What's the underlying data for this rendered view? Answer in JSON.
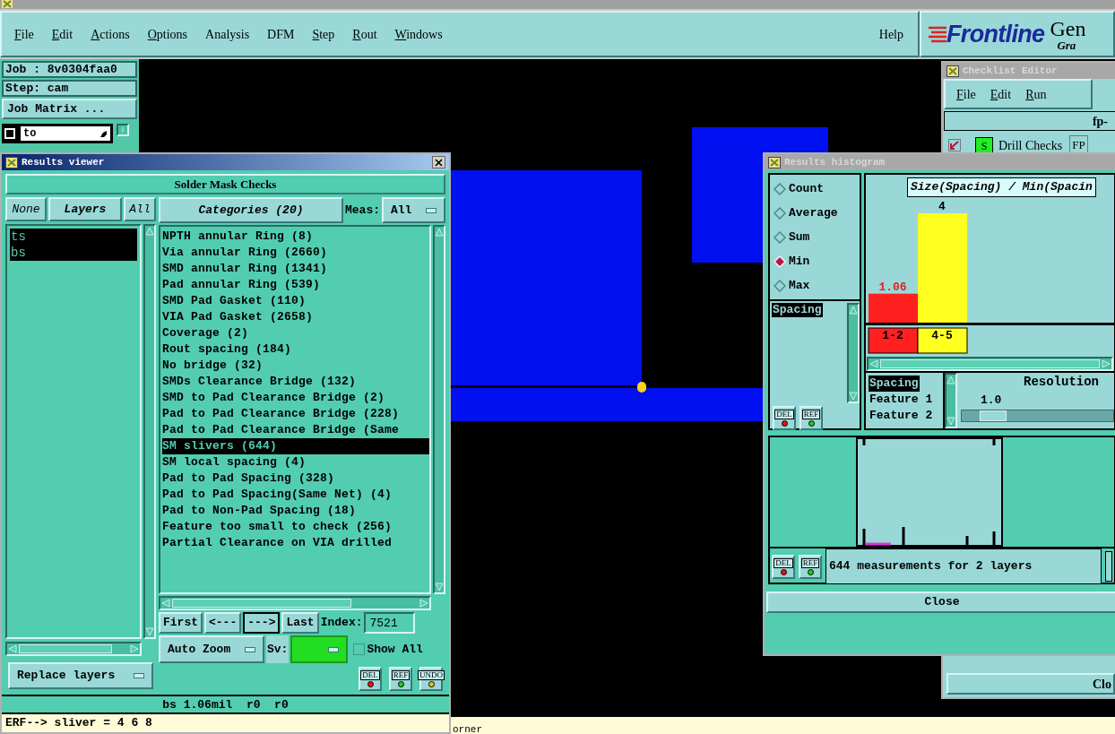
{
  "menu_bar": {
    "items": [
      {
        "label": "File",
        "mnemonic": true
      },
      {
        "label": "Edit",
        "mnemonic": true
      },
      {
        "label": "Actions",
        "mnemonic": true
      },
      {
        "label": "Options",
        "mnemonic": true
      },
      {
        "label": "Analysis",
        "mnemonic": false
      },
      {
        "label": "DFM",
        "mnemonic": false
      },
      {
        "label": "Step",
        "mnemonic": true
      },
      {
        "label": "Rout",
        "mnemonic": true
      },
      {
        "label": "Windows",
        "mnemonic": true
      }
    ],
    "help": "Help",
    "logo": "Frontline",
    "product": "Gen",
    "product_sub": "Gra"
  },
  "side_panel": {
    "job": "Job : 8v0304faa0",
    "step": "Step: cam",
    "job_matrix": "Job Matrix ...",
    "layer_row": {
      "checked": false,
      "value": "to"
    }
  },
  "status_line": "orner",
  "checklist_editor": {
    "title": "Checklist Editor",
    "menu": [
      "File",
      "Edit",
      "Run"
    ],
    "checklist_name": "fp-",
    "rows": [
      {
        "checked": true,
        "status": "S",
        "name": "Drill Checks",
        "column_3": "FP"
      }
    ],
    "close": "Clo"
  },
  "results_viewer": {
    "title": "Results viewer",
    "heading": "Solder Mask Checks",
    "layer_buttons": {
      "none": "None",
      "layers": "Layers",
      "all": "All"
    },
    "layers": [
      {
        "name": "ts",
        "selected": true
      },
      {
        "name": "bs",
        "selected": true
      }
    ],
    "categories_button": "Categories (20)",
    "meas_label": "Meas:",
    "meas_value": "All",
    "categories": [
      {
        "label": "NPTH annular Ring (8)",
        "selected": false
      },
      {
        "label": "Via annular Ring (2660)",
        "selected": false
      },
      {
        "label": "SMD annular Ring (1341)",
        "selected": false
      },
      {
        "label": "Pad annular Ring (539)",
        "selected": false
      },
      {
        "label": "SMD Pad Gasket (110)",
        "selected": false
      },
      {
        "label": "VIA Pad Gasket (2658)",
        "selected": false
      },
      {
        "label": "Coverage (2)",
        "selected": false
      },
      {
        "label": "Rout spacing (184)",
        "selected": false
      },
      {
        "label": "No bridge (32)",
        "selected": false
      },
      {
        "label": "SMDs Clearance Bridge (132)",
        "selected": false
      },
      {
        "label": "SMD to Pad Clearance Bridge (2)",
        "selected": false
      },
      {
        "label": "Pad to Pad Clearance Bridge (228)",
        "selected": false
      },
      {
        "label": "Pad to Pad Clearance Bridge (Same",
        "selected": false
      },
      {
        "label": "SM slivers (644)",
        "selected": true
      },
      {
        "label": "SM local spacing (4)",
        "selected": false
      },
      {
        "label": "Pad to Pad Spacing (328)",
        "selected": false
      },
      {
        "label": "Pad to Pad Spacing(Same Net) (4)",
        "selected": false
      },
      {
        "label": "Pad to Non-Pad Spacing (18)",
        "selected": false
      },
      {
        "label": "Feature too small to check (256)",
        "selected": false
      },
      {
        "label": "Partial Clearance on VIA drilled",
        "selected": false
      }
    ],
    "nav": [
      {
        "label": "First",
        "selected": false
      },
      {
        "label": "<---",
        "selected": false
      },
      {
        "label": "--->",
        "selected": true
      },
      {
        "label": "Last",
        "selected": false
      }
    ],
    "index_label": "Index:",
    "index_value": "7521",
    "replace_layers": "Replace layers",
    "zoom": "Auto Zoom",
    "sv_label": "Sv:",
    "show_all": {
      "label": "Show All",
      "checked": false
    },
    "tools": [
      {
        "label": "DEL",
        "color": "#ee1111"
      },
      {
        "label": "REF",
        "color": "#22cc22"
      },
      {
        "label": "UNDO",
        "color": "#e8c020"
      }
    ],
    "status": "bs 1.06mil  r0  r0",
    "command": "ERF--> sliver = 4 6 8"
  },
  "results_histogram": {
    "title": "Results histogram",
    "modes": [
      {
        "label": "Count",
        "selected": false
      },
      {
        "label": "Average",
        "selected": false
      },
      {
        "label": "Sum",
        "selected": false
      },
      {
        "label": "Min",
        "selected": true
      },
      {
        "label": "Max",
        "selected": false
      }
    ],
    "attributes": [
      {
        "label": "Spacing",
        "selected": true
      }
    ],
    "attribute_tools": [
      {
        "label": "DEL",
        "color": "#ee1111"
      },
      {
        "label": "REF",
        "color": "#22cc22"
      }
    ],
    "chart_data": {
      "type": "bar",
      "title": "Size(Spacing) / Min(Spacin",
      "categories": [
        "1-2",
        "4-5"
      ],
      "series": [
        {
          "values": [
            1.06,
            4
          ]
        }
      ],
      "data_labels": true
    },
    "bins": [
      {
        "color": "#ff2020",
        "flagged": true
      },
      {
        "color": "#ffff20",
        "flagged": false
      }
    ],
    "summary_tools": [
      {
        "label": "DEL",
        "color": "#ee1111"
      },
      {
        "label": "REF",
        "color": "#22cc22"
      }
    ],
    "fields": [
      {
        "label": "Spacing",
        "selected": true
      },
      {
        "label": "Feature 1",
        "selected": false
      },
      {
        "label": "Feature 2",
        "selected": false
      }
    ],
    "resolution": {
      "label": "Resolution",
      "value": "1.0"
    },
    "summary": "644 measurements for 2 layers",
    "close": "Close"
  }
}
